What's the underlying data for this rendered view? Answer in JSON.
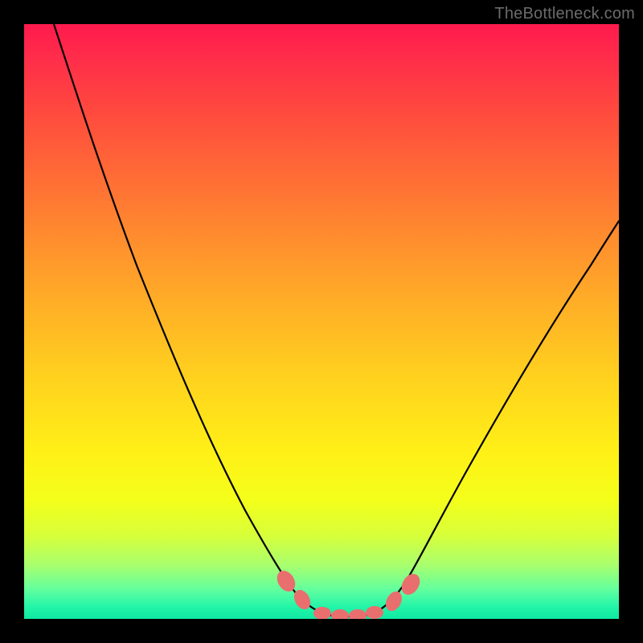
{
  "watermark": "TheBottleneck.com",
  "colors": {
    "frame": "#000000",
    "curve": "#000000",
    "marker": "#e96f6f",
    "gradient_top": "#ff1a4d",
    "gradient_bottom": "#10e8a2"
  },
  "chart_data": {
    "type": "line",
    "title": "",
    "xlabel": "",
    "ylabel": "",
    "xlim": [
      0,
      100
    ],
    "ylim": [
      0,
      100
    ],
    "grid": false,
    "legend": false,
    "note": "Axis values are normalized 0–100 (no tick labels visible). y=100 at top (worst / red), y≈0 at bottom (best / green). The curve's minimum is the optimal region.",
    "series": [
      {
        "name": "bottleneck-curve",
        "x": [
          5,
          10,
          15,
          20,
          25,
          30,
          35,
          40,
          43,
          46,
          49,
          52,
          55,
          58,
          61,
          64,
          68,
          72,
          77,
          83,
          90,
          97,
          100
        ],
        "y": [
          100,
          90,
          79,
          68,
          57,
          46,
          35,
          23,
          14,
          7,
          2.5,
          0.8,
          0.4,
          0.6,
          1.2,
          3,
          8,
          16,
          26,
          38,
          51,
          64,
          70
        ]
      }
    ],
    "markers": {
      "name": "highlight-points",
      "note": "Salmon oval markers near the valley (both slopes and flat bottom).",
      "x": [
        43.5,
        46.3,
        49.5,
        52.5,
        55.5,
        58.2,
        61.6,
        64.6
      ],
      "y": [
        12.8,
        6.0,
        1.7,
        0.6,
        0.5,
        0.8,
        2.2,
        5.2
      ]
    }
  }
}
